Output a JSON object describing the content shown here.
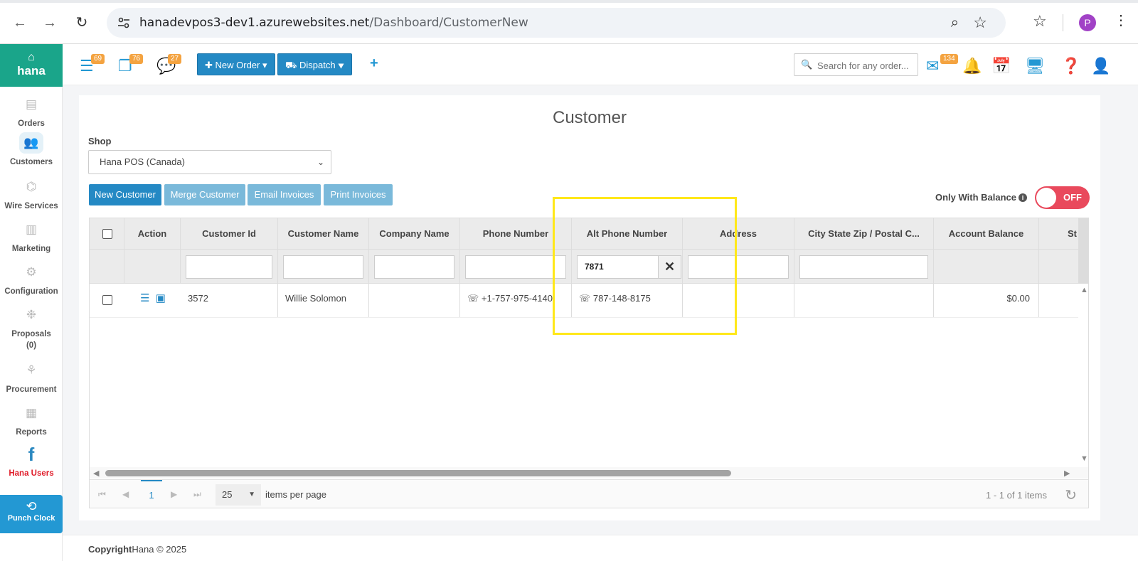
{
  "browser": {
    "url_domain": "hanadevpos3-dev1.azurewebsites.net",
    "url_path": "/Dashboard/CustomerNew",
    "profile_initial": "P"
  },
  "sidebar": {
    "brand": "hana",
    "items": [
      {
        "label": "Orders",
        "icon": "orders-icon"
      },
      {
        "label": "Customers",
        "icon": "customers-icon"
      },
      {
        "label": "Wire Services",
        "icon": "wire-services-icon"
      },
      {
        "label": "Marketing",
        "icon": "marketing-icon"
      },
      {
        "label": "Configuration",
        "icon": "gear-icon"
      },
      {
        "label": "Proposals",
        "count": "(0)",
        "icon": "proposals-icon"
      },
      {
        "label": "Procurement",
        "icon": "procurement-icon"
      },
      {
        "label": "Reports",
        "icon": "reports-icon"
      },
      {
        "label": "Hana Users",
        "icon": "facebook-icon"
      }
    ],
    "punch_clock": "Punch Clock"
  },
  "topbar": {
    "badges": [
      "69",
      "76",
      "27"
    ],
    "new_order": "New Order",
    "dispatch": "Dispatch",
    "search_placeholder": "Search for any order...",
    "mail_badge": "134"
  },
  "page": {
    "title": "Customer",
    "shop_label": "Shop",
    "shop_value": "Hana POS (Canada)",
    "buttons": {
      "new_customer": "New Customer",
      "merge_customer": "Merge Customer",
      "email_invoices": "Email Invoices",
      "print_invoices": "Print Invoices"
    },
    "only_with_balance": "Only With Balance",
    "toggle_state": "OFF"
  },
  "grid": {
    "columns": [
      "Action",
      "Customer Id",
      "Customer Name",
      "Company Name",
      "Phone Number",
      "Alt Phone Number",
      "Address",
      "City State Zip / Postal C...",
      "Account Balance",
      "St"
    ],
    "filter_alt_phone": "7871",
    "rows": [
      {
        "customer_id": "3572",
        "customer_name": "Willie Solomon",
        "company_name": "",
        "phone": "+1-757-975-4140",
        "alt_phone": "787-148-8175",
        "address": "",
        "city": "",
        "balance": "$0.00"
      }
    ],
    "pager": {
      "current_page": "1",
      "page_size": "25",
      "items_per_page": "items per page",
      "info": "1 - 1 of 1 items"
    }
  },
  "footer": {
    "copyright_bold": "Copyright",
    "copyright_rest": "Hana © 2025"
  }
}
